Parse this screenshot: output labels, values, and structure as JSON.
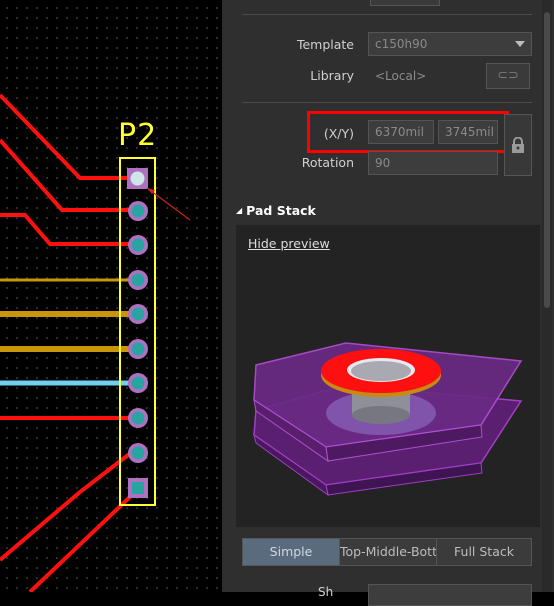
{
  "canvas": {
    "designator": "P2",
    "pad_count": 10
  },
  "panel": {
    "template_label": "Template",
    "template_value": "c150h90",
    "library_label": "Library",
    "library_value": "<Local>",
    "link_icon_text": "⊂⊃",
    "xy_label": "(X/Y)",
    "x_value": "6370mil",
    "y_value": "3745mil",
    "rotation_label": "Rotation",
    "rotation_value": "90",
    "pad_stack_title": "Pad Stack",
    "pad_stack_arrow": "◢",
    "hide_preview": "Hide preview",
    "modes": [
      "Simple",
      "Top-Middle-Bott",
      "Full Stack"
    ],
    "active_mode": "Simple",
    "bottom_label": "Sh"
  },
  "colors": {
    "track_red": "#ff1010",
    "track_gold": "#c8960a",
    "track_cyan": "#6fd0f0",
    "outline_yellow": "#ffff33",
    "pad_purple": "#b070c0",
    "pad_teal": "#2aa3a3",
    "highlight_red": "#ff0000",
    "copper_purple": "#7a1f8f",
    "ring_red": "#ff1010"
  }
}
